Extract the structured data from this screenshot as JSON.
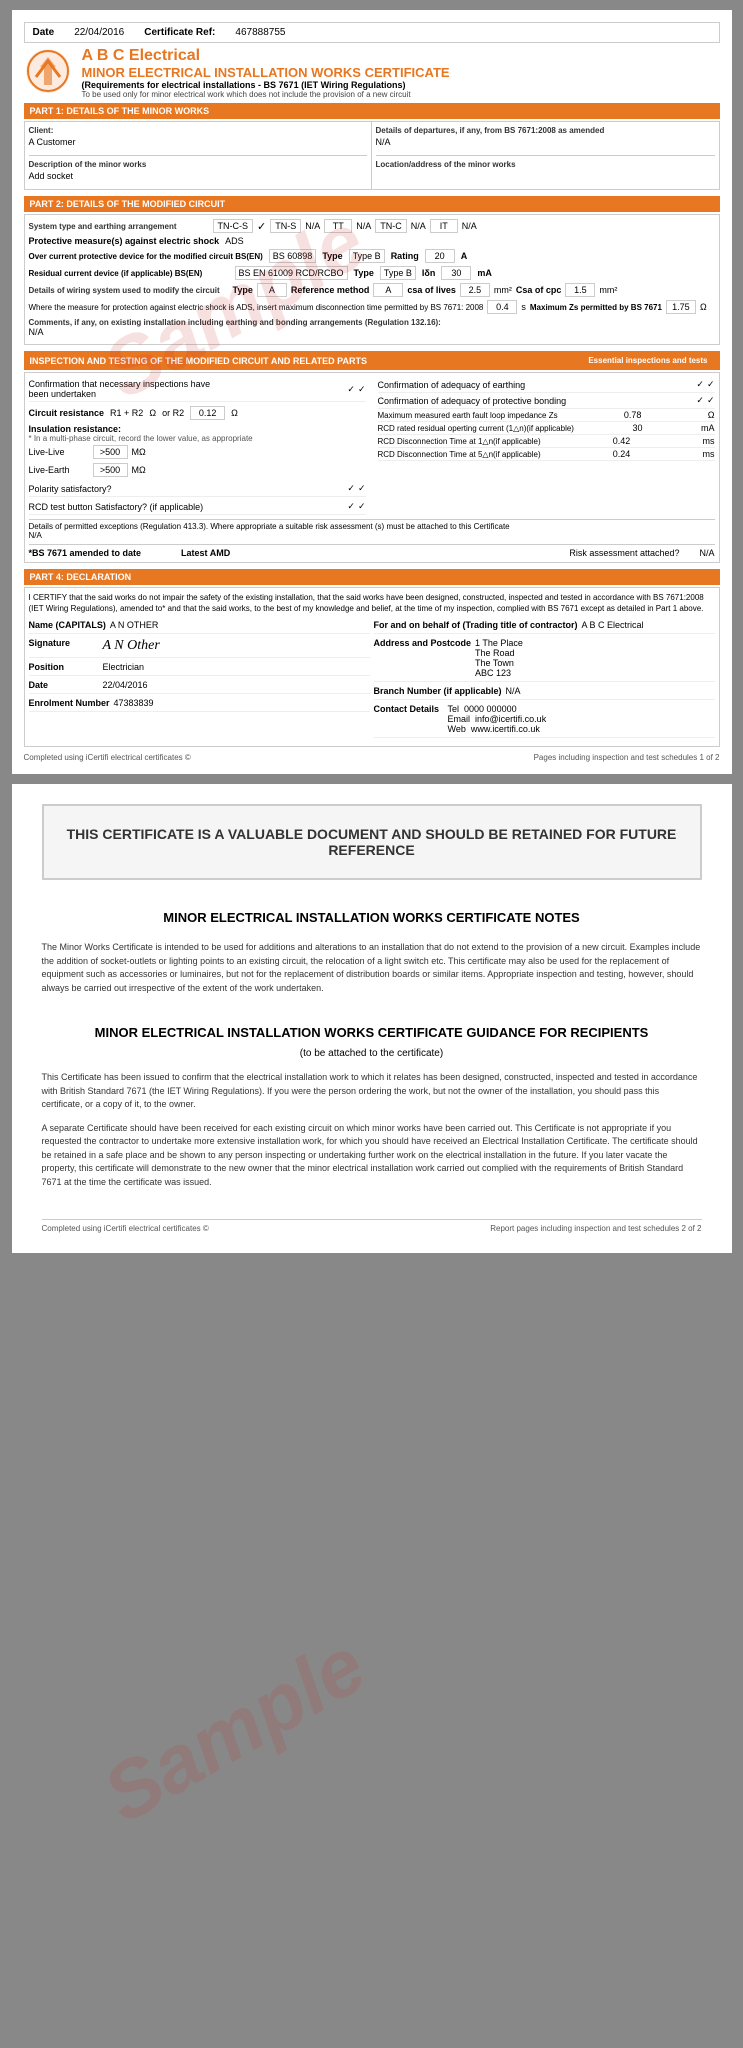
{
  "page1": {
    "header": {
      "date_label": "Date",
      "date_value": "22/04/2016",
      "cert_ref_label": "Certificate Ref:",
      "cert_ref_value": "467888755"
    },
    "company": {
      "name": "A B C Electrical",
      "cert_title": "MINOR ELECTRICAL INSTALLATION WORKS CERTIFICATE",
      "regs": "(Requirements for electrical installations - BS 7671 (IET Wiring Regulations)",
      "minor_note": "To be used only for minor electrical work which does not include the provision of a new circuit"
    },
    "part1": {
      "header": "PART 1: DETAILS OF THE MINOR WORKS",
      "client_label": "Client:",
      "client_value": "A Customer",
      "description_label": "Description of the minor works",
      "description_value": "Add socket",
      "departures_label": "Details of departures, if any, from BS 7671:2008 as amended",
      "departures_value": "N/A",
      "location_label": "Location/address of the minor works",
      "location_value": ""
    },
    "part2": {
      "header": "PART 2: DETAILS OF THE MODIFIED CIRCUIT",
      "system_label": "System type and earthing arrangement",
      "systems": [
        {
          "name": "TN-C-S",
          "checked": true
        },
        {
          "name": "TN-S",
          "value": "N/A"
        },
        {
          "name": "TT",
          "value": "N/A"
        },
        {
          "name": "TN-C",
          "value": "N/A"
        },
        {
          "name": "IT",
          "value": "N/A"
        }
      ],
      "protective_label": "Protective measure(s) against electric shock",
      "protective_value": "ADS",
      "overcurrent_label": "Over current protective device for the modified circuit BS(EN)",
      "overcurrent_ref": "BS 60898",
      "overcurrent_type_label": "Type",
      "overcurrent_type_value": "Type B",
      "overcurrent_rating_label": "Rating",
      "overcurrent_rating_value": "20",
      "overcurrent_unit": "A",
      "rcd_label": "Residual current device (if applicable) BS(EN)",
      "rcd_ref": "BS EN 61009 RCD/RCBO",
      "rcd_type_label": "Type",
      "rcd_type_value": "Type B",
      "rcd_idan_label": "Iδn",
      "rcd_idan_value": "30",
      "rcd_unit": "mA",
      "wiring_label": "Details of wiring system used to modify the circuit",
      "wiring_type_label": "Type",
      "wiring_type_value": "A",
      "wiring_ref_label": "Reference method",
      "wiring_ref_value": "A",
      "wiring_csa_label": "csa of lives",
      "wiring_csa_value": "2.5",
      "wiring_csa_unit": "mm²",
      "wiring_cpc_label": "Csa of cpc",
      "wiring_cpc_value": "1.5",
      "wiring_cpc_unit": "mm²",
      "protection_label": "Where the measure for protection against electric shock is ADS, insert maximum disconnection time permitted by BS 7671: 2008",
      "protection_value": "0.4",
      "protection_unit": "s",
      "protection_max_label": "Maximum Zs permitted by BS 7671",
      "protection_max_value": "1.75",
      "protection_max_unit": "Ω",
      "comments_label": "Comments, if any, on existing installation including earthing and bonding arrangements (Regulation 132.16):",
      "comments_value": "N/A"
    },
    "part3": {
      "header": "INSPECTION AND TESTING OF THE MODIFIED CIRCUIT AND RELATED PARTS",
      "essential_label": "Essential inspections and tests",
      "inspections_confirmed_label": "Confirmation that necessary inspections have been undertaken",
      "inspections_confirmed_v1": "✓",
      "inspections_confirmed_v2": "✓",
      "earthing_adequacy_label": "Confirmation of adequacy of earthing",
      "earthing_v1": "✓",
      "earthing_v2": "✓",
      "circuit_resistance_label": "Circuit resistance",
      "r1r2_label": "R1 + R2",
      "r1r2_unit": "Ω",
      "orR2_label": "or R2",
      "orR2_value": "0.12",
      "orR2_unit": "Ω",
      "bonding_label": "Confirmation of adequacy of protective bonding",
      "bonding_v1": "✓",
      "bonding_v2": "✓",
      "insulation_label": "Insulation resistance:",
      "insulation_sub": "* In a multi-phase circuit, record the lower value, as appropriate",
      "polarity_label": "Polarity satisfactory?",
      "polarity_v1": "✓",
      "polarity_v2": "✓",
      "max_earth_fault_label": "Maximum measured earth fault loop impedance Zs",
      "max_earth_fault_value": "0.78",
      "max_earth_fault_unit": "Ω",
      "rcd_test_label": "RCD test button Satisfactory? (if applicable)",
      "rcd_test_v1": "✓",
      "rcd_test_v2": "✓",
      "rcd_rated_label": "RCD rated residual operting current (1△n)(if applicable)",
      "rcd_rated_value": "30",
      "rcd_rated_unit": "mA",
      "live_live_label": "Live-Live",
      "live_live_value": ">500",
      "live_live_unit": "MΩ",
      "rcd_time1_label": "RCD Disconnection Time at 1△n(if applicable)",
      "rcd_time1_value": "0.42",
      "rcd_time1_unit": "ms",
      "live_earth_label": "Live-Earth",
      "live_earth_value": ">500",
      "live_earth_unit": "MΩ",
      "rcd_time2_label": "RCD Disconnection Time at 5△n(if applicable)",
      "rcd_time2_value": "0.24",
      "rcd_time2_unit": "ms",
      "details_note": "Details of permitted exceptions (Regulation 413.3). Where appropriate a suitable risk assessment (s) must be attached to this Certificate",
      "details_value": "N/A",
      "bs7671_label": "*BS 7671 amended to date",
      "bs7671_value": "",
      "latest_amd_label": "Latest AMD",
      "risk_label": "Risk assessment attached?",
      "risk_value": "N/A"
    },
    "part4": {
      "header": "PART 4: DECLARATION",
      "declaration_text": "I CERTIFY that the said works do not impair the safety of the existing installation, that the said works have been designed, constructed, inspected and tested in accordance with BS 7671:2008 (IET Wiring Regulations), amended to* and that the said works, to the best of my knowledge and belief, at the time of my inspection, complied with BS 7671 except as detailed in Part 1 above.",
      "name_label": "Name (CAPITALS)",
      "name_value": "A N OTHER",
      "for_label": "For and on behalf of (Trading title of contractor)",
      "for_value": "A B C Electrical",
      "signature_label": "Signature",
      "signature_value": "A N Other",
      "address_label": "Address and Postcode",
      "address_value": "1 The Place\nThe Road\nThe Town\nABC 123",
      "position_label": "Position",
      "position_value": "Electrician",
      "branch_label": "Branch Number (if applicable)",
      "branch_value": "N/A",
      "date_label": "Date",
      "date_value": "22/04/2016",
      "contact_label": "Contact Details",
      "tel_label": "Tel",
      "tel_value": "0000 000000",
      "email_label": "Email",
      "email_value": "info@icertifi.co.uk",
      "web_label": "Web",
      "web_value": "www.icertifi.co.uk",
      "enrolment_label": "Enrolment Number",
      "enrolment_value": "47383839"
    },
    "footer": {
      "left": "Completed using iCertifi electrical certificates ©",
      "right": "Pages including inspection and test schedules 1 of 2"
    }
  },
  "page2": {
    "valuable_title": "THIS CERTIFICATE IS A VALUABLE DOCUMENT AND SHOULD BE RETAINED FOR FUTURE REFERENCE",
    "notes_title": "MINOR ELECTRICAL INSTALLATION WORKS CERTIFICATE NOTES",
    "notes_text": "The Minor Works Certificate is intended to be used for additions and alterations to an installation that do not extend to the provision of a new circuit. Examples include the addition of socket-outlets or lighting points to an existing circuit, the relocation of a light switch etc. This certificate may also be used for the replacement of equipment such as accessories or luminaires, but not for the replacement of distribution boards or similar items. Appropriate inspection and testing, however, should always be carried out irrespective of the extent of the work undertaken.",
    "guidance_title": "MINOR ELECTRICAL INSTALLATION WORKS CERTIFICATE GUIDANCE FOR RECIPIENTS",
    "guidance_subtitle": "(to be attached to the certificate)",
    "guidance_text1": "This Certificate has been issued to confirm that the electrical installation work to which it relates has been designed, constructed, inspected and tested in accordance with British Standard 7671 (the IET Wiring Regulations). If you were the person ordering the work, but not the owner of the installation, you should pass this certificate, or a copy of it, to the owner.",
    "guidance_text2": "A separate Certificate should have been received for each existing circuit on which minor works have been carried out. This Certificate is not appropriate if you requested the contractor to undertake more extensive installation work, for which you should have received an Electrical Installation Certificate. The certificate should be retained in a safe place and be shown to any person inspecting or undertaking further work on the electrical installation in the future. If you later vacate the property, this certificate will demonstrate to the new owner that the minor electrical installation work carried out complied with the requirements of British Standard 7671 at the time the certificate was issued.",
    "footer_left": "Completed using iCertifi electrical certificates ©",
    "footer_right": "Report pages including inspection and test schedules 2 of 2",
    "sample_text": "Sample"
  }
}
